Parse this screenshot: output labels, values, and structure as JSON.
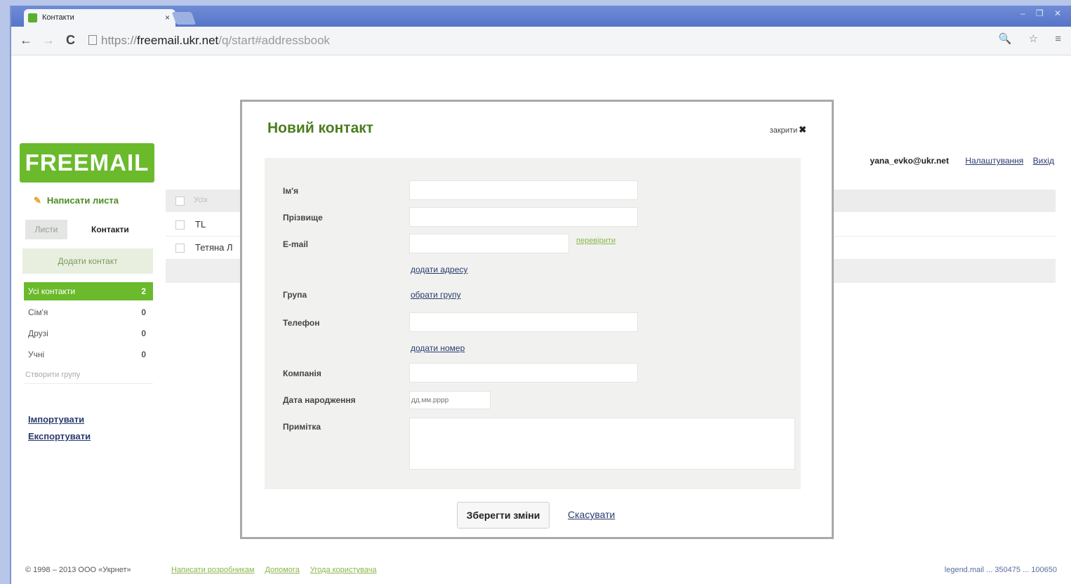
{
  "browser": {
    "tab_title": "Контакти",
    "tab_close": "×",
    "url_protocol": "https://",
    "url_host": "freemail.ukr.net",
    "url_path": "/q/start#addressbook",
    "back": "←",
    "forward": "→",
    "reload": "C",
    "window_controls": "– ❐ ✕",
    "toolbar_icons": "🔍 ☆ ≡"
  },
  "sidebar": {
    "logo": "FREEMAIL",
    "compose_label": "Написати листа",
    "tab_letters": "Листи",
    "tab_contacts": "Контакти",
    "add_contact": "Додати контакт",
    "groups": [
      {
        "label": "Усі контакти",
        "count": "2",
        "active": true
      },
      {
        "label": "Сім'я",
        "count": "0"
      },
      {
        "label": "Друзі",
        "count": "0"
      },
      {
        "label": "Учні",
        "count": "0"
      }
    ],
    "new_group": "Створити групу",
    "import_link": "Імпортувати",
    "export_link": "Експортувати"
  },
  "header": {
    "email": "yana_evko@ukr.net",
    "settings_link": "Налаштування",
    "logout_link": "Вихід"
  },
  "list": {
    "select_label": "Усіх",
    "rows": [
      "TL",
      "Тетяна Л"
    ]
  },
  "modal": {
    "title": "Новий контакт",
    "close_label": "закрити",
    "close_x": "✖",
    "fields": {
      "name_label": "Ім'я",
      "surname_label": "Прізвище",
      "email_label": "E-mail",
      "check_link": "перевірити",
      "add_email_link": "додати адресу",
      "group_label": "Група",
      "choose_group_link": "обрати групу",
      "phone_label": "Телефон",
      "add_phone_link": "додати номер",
      "company_label": "Компанія",
      "birthday_label": "Дата народження",
      "birthday_placeholder": "дд.мм.рррр",
      "note_label": "Примітка"
    },
    "save_button": "Зберегти зміни",
    "cancel_link": "Скасувати"
  },
  "footer": {
    "copyright": "© 1998 – 2013 ООО «Укрнет»",
    "links": [
      "Написати розробникам",
      "Допомога",
      "Угода користувача"
    ],
    "right_text": "legend.mail ... 350475 ... 100650"
  }
}
